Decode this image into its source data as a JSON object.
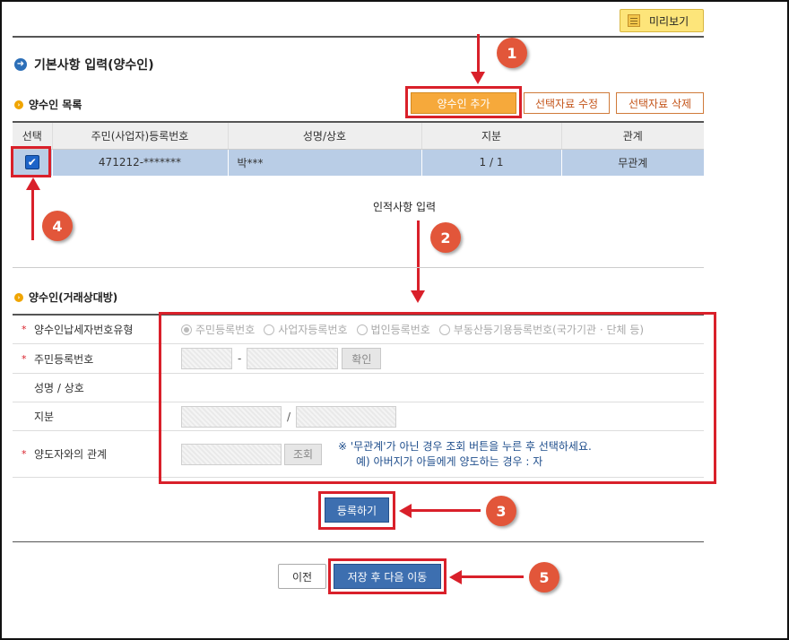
{
  "header": {
    "preview_label": "미리보기"
  },
  "page": {
    "title": "기본사항 입력(양수인)"
  },
  "list_section": {
    "title": "양수인 목록",
    "add_label": "양수인 추가",
    "edit_label": "선택자료 수정",
    "delete_label": "선택자료 삭제",
    "columns": [
      "선택",
      "주민(사업자)등록번호",
      "성명/상호",
      "지분",
      "관계"
    ],
    "rows": [
      {
        "checked": true,
        "id_number": "471212-*******",
        "name": "박***",
        "share": "1 / 1",
        "relation": "무관계"
      }
    ]
  },
  "annotation_text": "인적사항 입력",
  "badges": [
    "1",
    "2",
    "3",
    "4",
    "5"
  ],
  "form_section": {
    "title": "양수인(거래상대방)",
    "rows": {
      "type_label": "양수인납세자번호유형",
      "id_label": "주민등록번호",
      "name_label": "성명 / 상호",
      "share_label": "지분",
      "relation_label": "양도자와의 관계"
    },
    "radio_options": [
      "주민등록번호",
      "사업자등록번호",
      "법인등록번호",
      "부동산등기용등록번호(국가기관 · 단체 등)"
    ],
    "id_separator": "-",
    "share_separator": "/",
    "confirm_label": "확인",
    "lookup_label": "조회",
    "note_line1": "※ '무관계'가 아닌 경우 조회 버튼을 누른 후 선택하세요.",
    "note_line2": "예) 아버지가 아들에게 양도하는 경우 : 자",
    "register_label": "등록하기"
  },
  "footer": {
    "prev_label": "이전",
    "save_next_label": "저장 후 다음 이동"
  },
  "colors": {
    "accent_red": "#d9202a",
    "badge": "#e2563a",
    "primary_blue": "#3d6fb0",
    "orange": "#f6a93b",
    "row_selected": "#b9cde6"
  }
}
